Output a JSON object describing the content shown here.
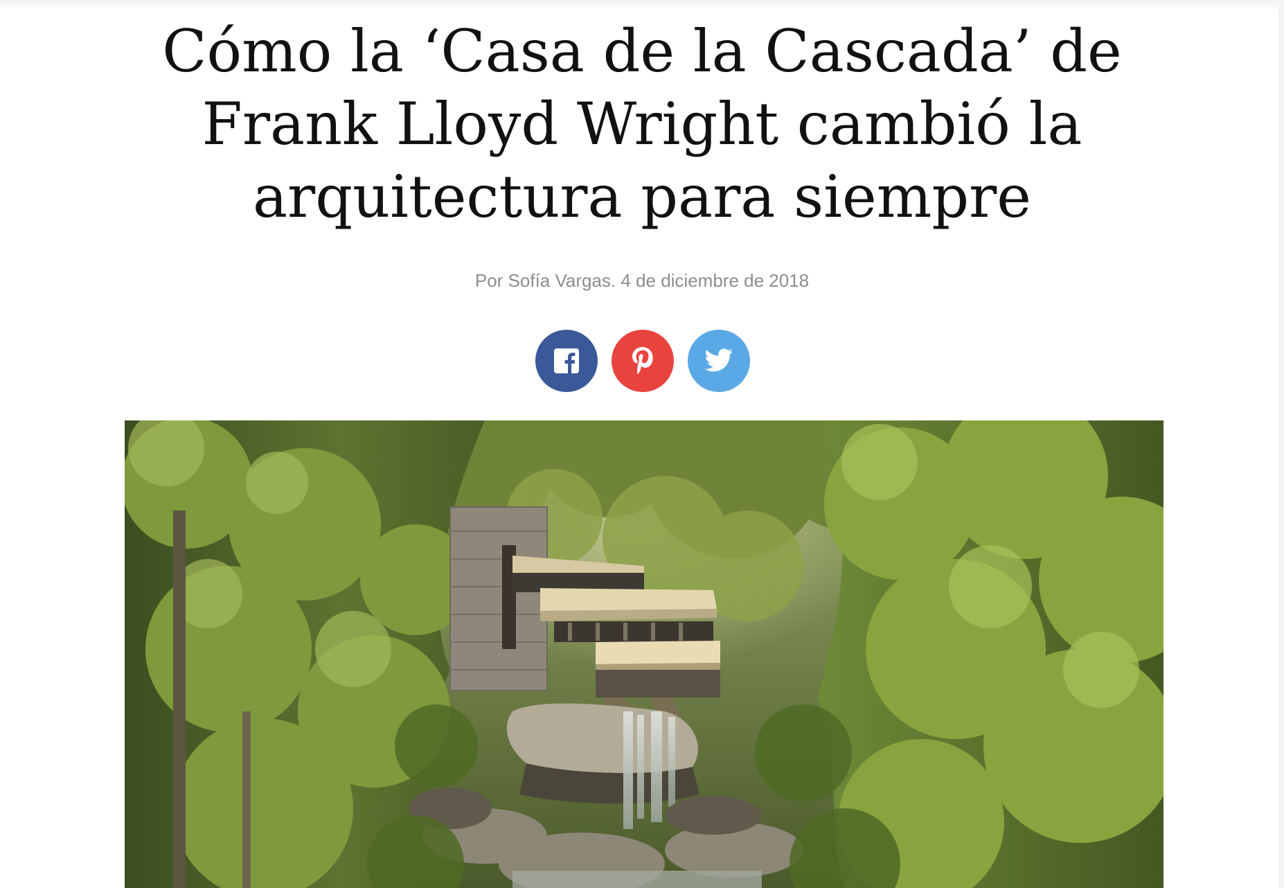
{
  "article": {
    "title_lines": [
      "Cómo la ‘Casa de la Cascada’ de",
      "Frank Lloyd Wright cambió la",
      "arquitectura para siempre"
    ],
    "byline": "Por Sofía Vargas. 4 de diciembre de 2018"
  },
  "share": [
    {
      "network": "Facebook",
      "icon": "facebook-icon",
      "color": "#3b5998"
    },
    {
      "network": "Pinterest",
      "icon": "pinterest-icon",
      "color": "#e8433e"
    },
    {
      "network": "Twitter",
      "icon": "twitter-icon",
      "color": "#5aa9e6"
    }
  ],
  "hero_image": {
    "subject": "fallingwater-house-photo"
  }
}
